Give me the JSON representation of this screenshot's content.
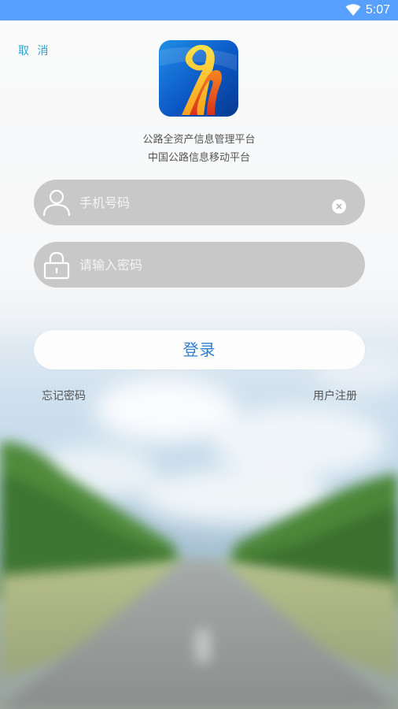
{
  "status_bar": {
    "time": "5:07",
    "icons": [
      "wifi-icon"
    ],
    "color": "#58a0ff"
  },
  "header": {
    "cancel_label": "取 消",
    "logo_icon": "highway-logo"
  },
  "app": {
    "subtitle_line1": "公路全资产信息管理平台",
    "subtitle_line2": "中国公路信息移动平台"
  },
  "form": {
    "phone_placeholder": "手机号码",
    "phone_value": "",
    "password_placeholder": "请输入密码",
    "password_value": "",
    "login_label": "登录"
  },
  "links": {
    "forgot_password": "忘记密码",
    "register": "用户注册"
  },
  "colors": {
    "accent": "#2d7fd0",
    "cancel": "#2aa3d6",
    "field_bg": "#c8c8c8"
  }
}
